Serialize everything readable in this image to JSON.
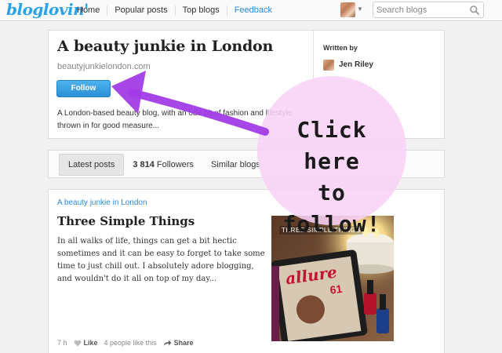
{
  "topbar": {
    "logo": "bloglovin'",
    "nav": [
      {
        "label": "Home"
      },
      {
        "label": "Popular posts"
      },
      {
        "label": "Top blogs"
      },
      {
        "label": "Feedback"
      }
    ],
    "search_placeholder": "Search blogs"
  },
  "blog": {
    "title": "A beauty junkie in London",
    "url": "beautyjunkielondon.com",
    "follow_label": "Follow",
    "description": "A London-based beauty blog, with an odd bit of fashion and lifestyle thrown in for good measure...",
    "written_by_label": "Written by",
    "author": "Jen Riley"
  },
  "tabs": {
    "latest": "Latest posts",
    "followers_count": "3 814",
    "followers_label": "Followers",
    "similar": "Similar blogs"
  },
  "post": {
    "blog_name": "A beauty junkie in London",
    "title": "Three Simple Things",
    "excerpt": "In all walks of life, things can get a bit hectic sometimes and it can be easy to forget to take some time to just chill out. I absolutely adore blogging, and wouldn't do it all on top of my day...",
    "image_caption": "THREE SIMPLE THINGS",
    "time": "7 h",
    "like_label": "Like",
    "likes_text": "4 people like this",
    "share_label": "Share"
  },
  "annotation": {
    "line1": "Click here",
    "line2": "to follow!"
  },
  "colors": {
    "brand": "#2aa3e6",
    "follow_button": "#2b8fd6",
    "link": "#2a8ad8",
    "arrow": "#a23ce6",
    "bubble": "#f8d2f6"
  }
}
